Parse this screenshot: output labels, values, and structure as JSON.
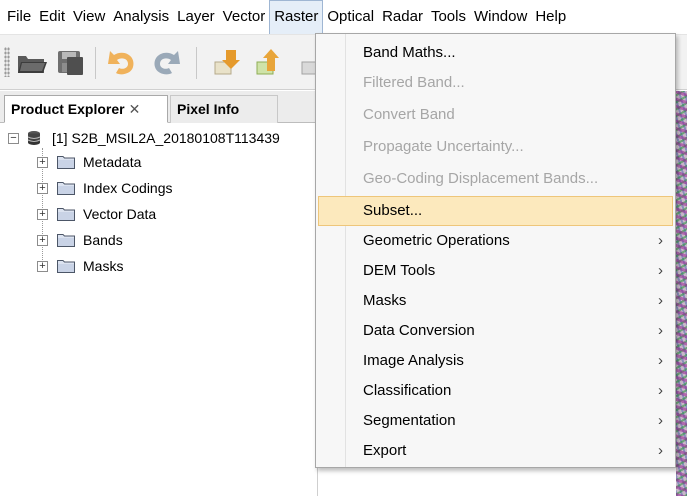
{
  "menubar": {
    "items": [
      "File",
      "Edit",
      "View",
      "Analysis",
      "Layer",
      "Vector",
      "Raster",
      "Optical",
      "Radar",
      "Tools",
      "Window",
      "Help"
    ],
    "active": "Raster"
  },
  "toolbar": {
    "icons": [
      "open-product-icon",
      "save-product-icon",
      "undo-icon",
      "redo-icon",
      "import-icon",
      "export-icon"
    ]
  },
  "tabs": [
    {
      "label": "Product Explorer",
      "close": "✕"
    },
    {
      "label": "Pixel Info"
    }
  ],
  "tree": {
    "product": "[1] S2B_MSIL2A_20180108T113439",
    "children": [
      "Metadata",
      "Index Codings",
      "Vector Data",
      "Bands",
      "Masks"
    ],
    "expander_symbol": "+",
    "collapse_symbol": "−"
  },
  "raster_menu": {
    "items": [
      {
        "label": "Band Maths...",
        "enabled": true,
        "submenu": false
      },
      {
        "label": "Filtered Band...",
        "enabled": false,
        "submenu": false
      },
      {
        "label": "Convert Band",
        "enabled": false,
        "submenu": false
      },
      {
        "label": "Propagate Uncertainty...",
        "enabled": false,
        "submenu": false
      },
      {
        "label": "Geo-Coding Displacement Bands...",
        "enabled": false,
        "submenu": false
      },
      {
        "label": "Subset...",
        "enabled": true,
        "submenu": false,
        "highlighted": true
      },
      {
        "label": "Geometric Operations",
        "enabled": true,
        "submenu": true
      },
      {
        "label": "DEM Tools",
        "enabled": true,
        "submenu": true
      },
      {
        "label": "Masks",
        "enabled": true,
        "submenu": true
      },
      {
        "label": "Data Conversion",
        "enabled": true,
        "submenu": true
      },
      {
        "label": "Image Analysis",
        "enabled": true,
        "submenu": true
      },
      {
        "label": "Classification",
        "enabled": true,
        "submenu": true
      },
      {
        "label": "Segmentation",
        "enabled": true,
        "submenu": true
      },
      {
        "label": "Export",
        "enabled": true,
        "submenu": true
      }
    ],
    "submenu_arrow": "›"
  },
  "colors": {
    "menu_highlight": "#fce9bd",
    "menu_highlight_border": "#eec67a",
    "disabled_text": "#a6a6a6",
    "folder": "#dce3f0"
  }
}
